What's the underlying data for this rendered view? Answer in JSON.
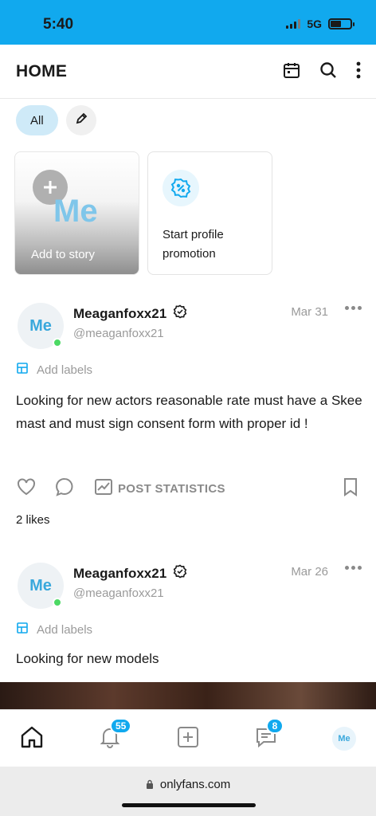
{
  "status_bar": {
    "time": "5:40",
    "network": "5G",
    "signal_bars": 3,
    "battery_level": 0.55
  },
  "header": {
    "title": "HOME",
    "icons": [
      "calendar-icon",
      "search-icon",
      "more-vertical-icon"
    ]
  },
  "filters": {
    "all_label": "All",
    "edit_icon": "pencil-icon"
  },
  "stories": {
    "add_story": {
      "avatar_text": "Me",
      "label": "Add to story",
      "icon": "plus-icon"
    },
    "promotion": {
      "label": "Start profile promotion",
      "icon": "discount-icon"
    }
  },
  "posts": [
    {
      "avatar_text": "Me",
      "author": "Meaganfoxx21",
      "handle": "@meaganfoxx21",
      "date": "Mar 31",
      "labels_text": "Add labels",
      "text": "Looking for new actors reasonable rate must have a Skee mast and must sign consent form with proper id !",
      "stats_label": "POST STATISTICS",
      "likes": "2 likes"
    },
    {
      "avatar_text": "Me",
      "author": "Meaganfoxx21",
      "handle": "@meaganfoxx21",
      "date": "Mar 26",
      "labels_text": "Add labels",
      "text": "Looking for new models"
    }
  ],
  "bottom_nav": {
    "notifications_count": "55",
    "messages_count": "8",
    "avatar_text": "Me"
  },
  "browser": {
    "url": "onlyfans.com"
  },
  "colors": {
    "brand": "#11a9ee",
    "chip_bg": "#cfeaf8",
    "online": "#4cd964"
  }
}
